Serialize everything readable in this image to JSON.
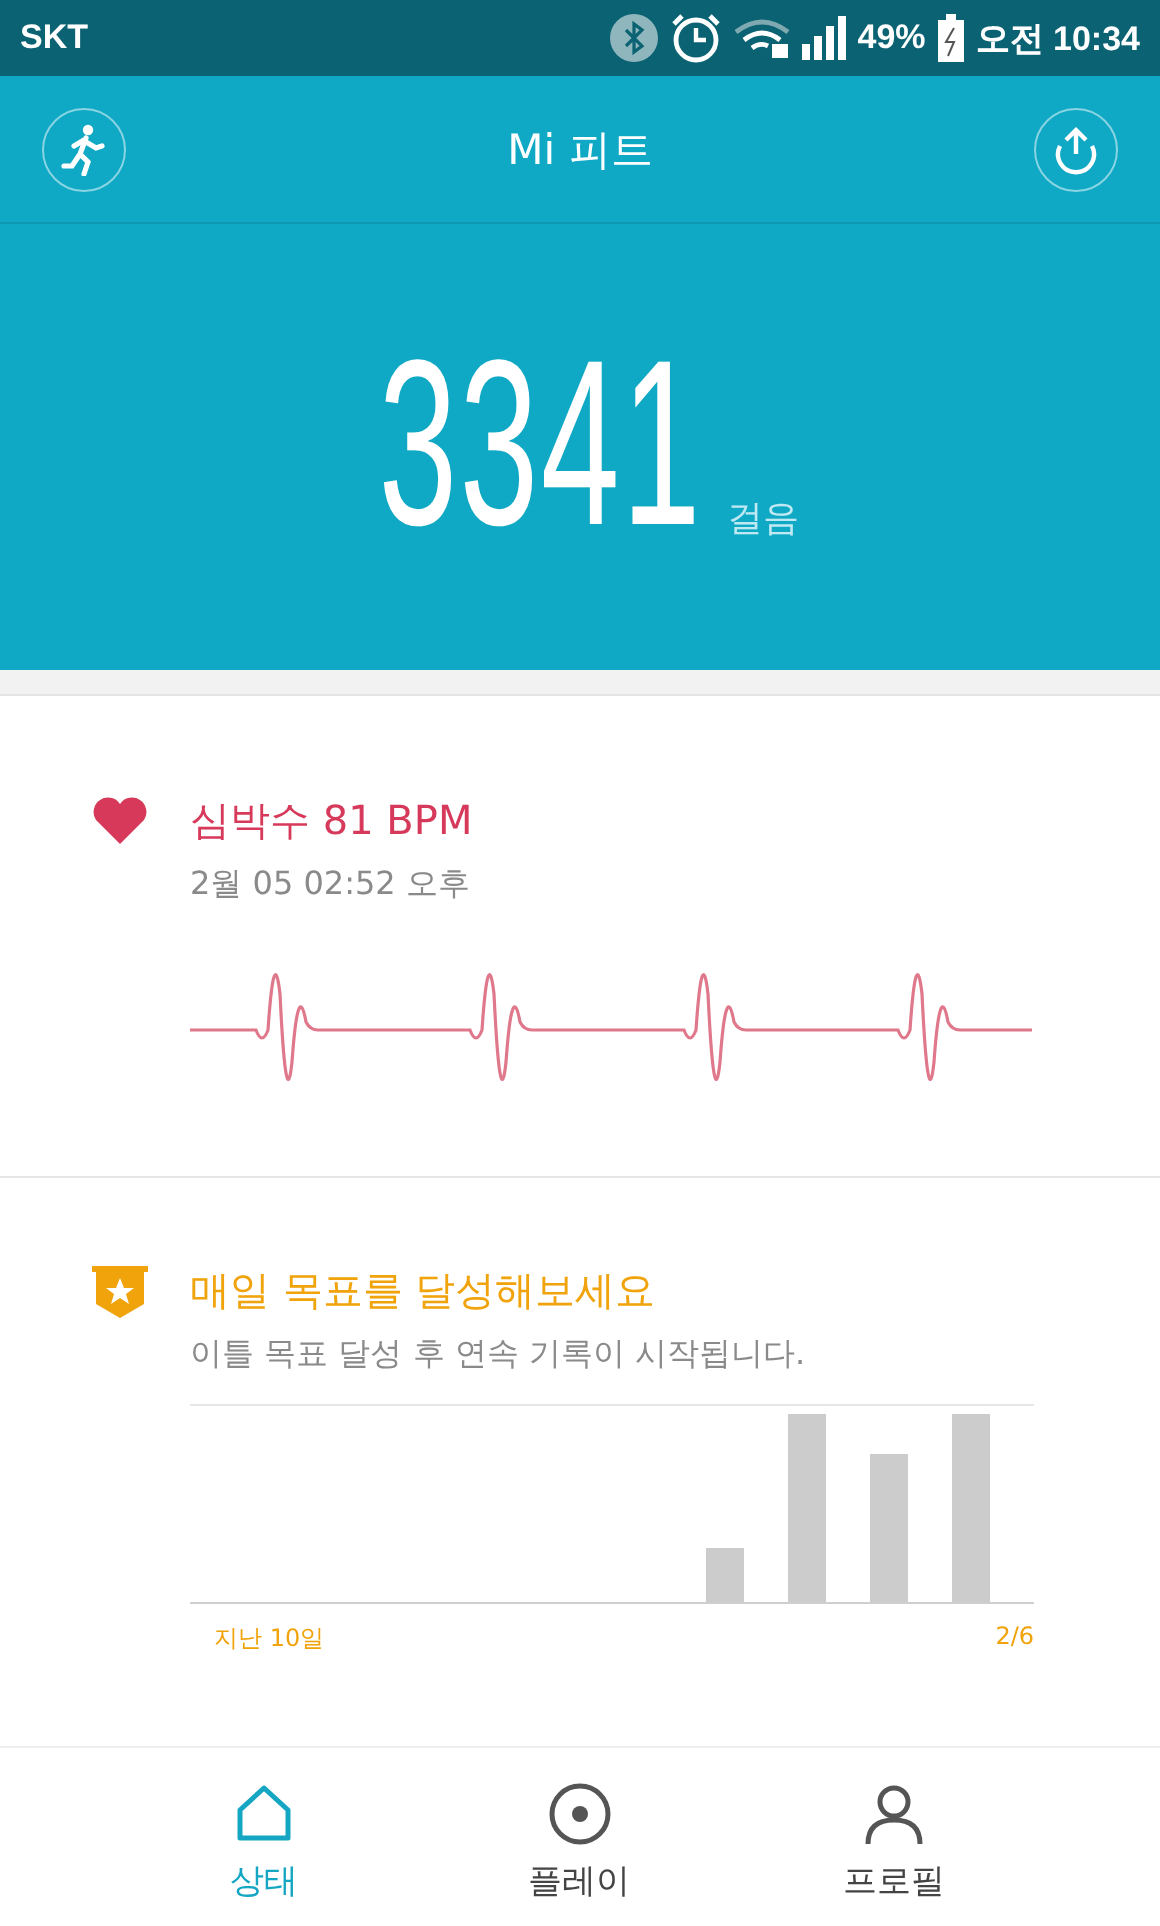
{
  "status_bar": {
    "carrier": "SKT",
    "battery": "49%",
    "time": "오전 10:34"
  },
  "header": {
    "title": "Mi 피트"
  },
  "steps": {
    "count": "3341",
    "unit": "걸음"
  },
  "heart_rate": {
    "title": "심박수 81 BPM",
    "time": "2월 05 02:52 오후"
  },
  "goal": {
    "title": "매일 목표를 달성해보세요",
    "subtitle": "이틀 목표 달성 후 연속 기록이 시작됩니다.",
    "chart_start_label": "지난 10일",
    "chart_end_label": "2/6"
  },
  "nav": [
    {
      "label": "상태",
      "selected": true,
      "kind": "home"
    },
    {
      "label": "플레이",
      "selected": false,
      "kind": "play"
    },
    {
      "label": "프로필",
      "selected": false,
      "kind": "profile"
    }
  ]
}
